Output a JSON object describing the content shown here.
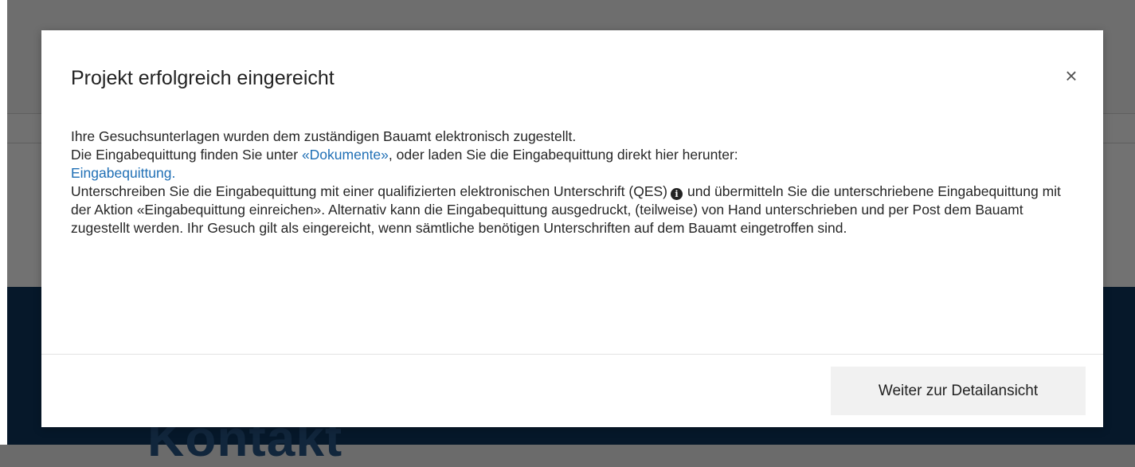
{
  "background": {
    "heading": "Kontakt"
  },
  "modal": {
    "title": "Projekt erfolgreich eingereicht",
    "close_glyph": "×",
    "line1": "Ihre Gesuchsunterlagen wurden dem zuständigen Bauamt elektronisch zugestellt.",
    "line2_prefix": "Die Eingabequittung finden Sie unter ",
    "documents_link": "«Dokumente»",
    "line2_suffix": ", oder laden Sie die Eingabequittung direkt hier herunter:",
    "receipt_link": "Eingabequittung.",
    "para3_prefix": "Unterschreiben Sie die Eingabequittung mit einer qualifizierten elektronischen Unterschrift (QES)",
    "info_glyph": "i",
    "para3_suffix": "und übermitteln Sie die unterschriebene Eingabequittung mit der Aktion «Eingabequittung einreichen». Alternativ kann die Eingabequittung ausgedruckt, (teilweise) von Hand unterschrieben und per Post dem Bauamt zugestellt werden. Ihr Gesuch gilt als eingereicht, wenn sämtliche benötigen Unterschriften auf dem Bauamt eingetroffen sind.",
    "continue_button": "Weiter zur Detailansicht"
  },
  "colors": {
    "link": "#1f6fb5",
    "backdrop_dark": "#06182a",
    "button_bg": "#f1f1f1"
  }
}
